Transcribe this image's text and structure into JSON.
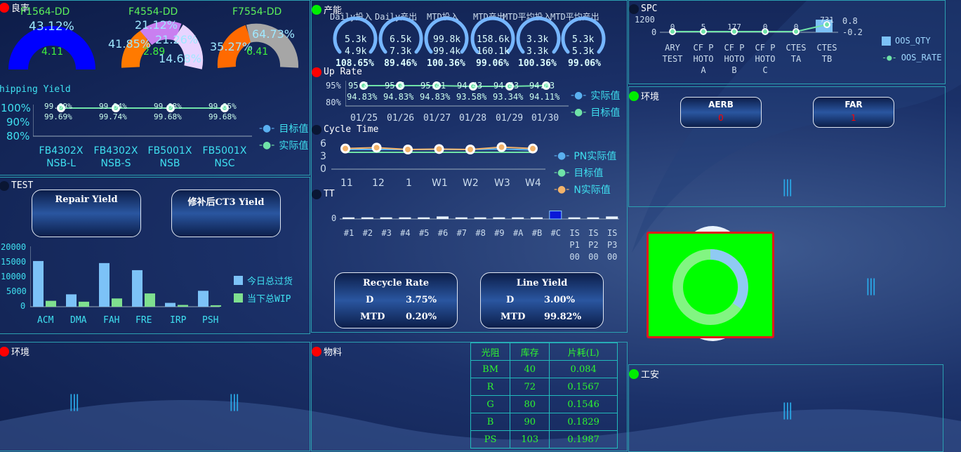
{
  "yield": {
    "title": "良率",
    "gauges": [
      {
        "name": "F1564-DD",
        "pct": "43.12%",
        "val": "4.11"
      },
      {
        "name": "F4554-DD",
        "pct_top": "21.12%",
        "pct_left": "41.85%",
        "pct_mid": "21.26%",
        "pct_right": "14.68%",
        "val": "2.89"
      },
      {
        "name": "F7554-DD",
        "pct_left": "35.27%",
        "pct_right": "64.73%",
        "val": "6.41"
      }
    ],
    "chipping_label": "hipping Yield",
    "yaxis": [
      "100%",
      "90%",
      "80%"
    ],
    "categories": [
      [
        "FB4302X",
        "NSB-L"
      ],
      [
        "FB4302X",
        "NSB-S"
      ],
      [
        "FB5001X",
        "NSB"
      ],
      [
        "FB5001X",
        "NSC"
      ]
    ],
    "target_labels": [
      "99.69%",
      "99.84%",
      "99.68%",
      "99.85%"
    ],
    "actual_labels": [
      "99.69%",
      "99.74%",
      "99.68%",
      "99.68%"
    ],
    "legend": [
      "目标值",
      "实际值"
    ]
  },
  "test": {
    "title": "TEST",
    "box1": "Repair Yield",
    "box2": "修补后CT3 Yield",
    "yaxis": [
      "20000",
      "15000",
      "10000",
      "5000",
      "0"
    ],
    "categories": [
      "ACM",
      "DMA",
      "FAH",
      "FRE",
      "IRP",
      "PSH"
    ],
    "legend": [
      "今日总过货",
      "当下总WIP"
    ],
    "chart_data": {
      "type": "bar",
      "categories": [
        "ACM",
        "DMA",
        "FAH",
        "FRE",
        "IRP",
        "PSH"
      ],
      "series": [
        {
          "name": "今日总过货",
          "values": [
            15500,
            4200,
            14800,
            12400,
            1300,
            5400
          ]
        },
        {
          "name": "当下总WIP",
          "values": [
            2000,
            1700,
            2800,
            4500,
            600,
            500
          ]
        }
      ],
      "ylim": [
        0,
        20000
      ]
    }
  },
  "env_left": {
    "title": "环境"
  },
  "capacity": {
    "title": "产能",
    "headers": [
      "Daily投入",
      "Daily产出",
      "MTD投入",
      "MTD产出",
      "MTD平均投入",
      "MTD平均产出"
    ],
    "gauges": [
      {
        "a": "5.3k",
        "b": "4.9k",
        "p": "108.65%"
      },
      {
        "a": "6.5k",
        "b": "7.3k",
        "p": "89.46%"
      },
      {
        "a": "99.8k",
        "b": "99.4k",
        "p": "100.36%"
      },
      {
        "a": "158.6k",
        "b": "160.1k",
        "p": "99.06%"
      },
      {
        "a": "3.3k",
        "b": "3.3k",
        "p": "100.36%"
      },
      {
        "a": "5.3k",
        "b": "5.3k",
        "p": "99.06%"
      }
    ]
  },
  "uprate": {
    "title": "Up Rate",
    "yaxis": [
      "95%",
      "80%"
    ],
    "dates": [
      "01/25",
      "01/26",
      "01/27",
      "01/28",
      "01/29",
      "01/30"
    ],
    "top_labels": [
      "95.4",
      "95.4",
      "95.41",
      "94.43",
      "94.43",
      "94.83"
    ],
    "bottom_labels": [
      "94.83%",
      "94.83%",
      "94.83%",
      "93.58%",
      "93.34%",
      "94.11%"
    ],
    "legend": [
      "实际值",
      "目标值"
    ]
  },
  "cycle": {
    "title": "Cycle Time",
    "yaxis": [
      "6",
      "3",
      "0"
    ],
    "categories": [
      "11",
      "12",
      "1",
      "W1",
      "W2",
      "W3",
      "W4"
    ],
    "legend": [
      "PN实际值",
      "目标值",
      "N实际值"
    ],
    "chart_data": {
      "type": "line",
      "categories": [
        "11",
        "12",
        "1",
        "W1",
        "W2",
        "W3",
        "W4"
      ],
      "series": [
        {
          "name": "PN实际值",
          "values": [
            4.2,
            4.2,
            4.2,
            4.2,
            4.2,
            4.3,
            4.1
          ]
        },
        {
          "name": "目标值",
          "values": [
            3.6,
            3.6,
            3.6,
            3.6,
            3.6,
            3.6,
            3.6
          ]
        },
        {
          "name": "N实际值",
          "values": [
            4.4,
            4.6,
            4.2,
            4.3,
            4.2,
            4.7,
            4.4
          ]
        }
      ],
      "ylim": [
        0,
        6
      ]
    }
  },
  "tt": {
    "title": "TT",
    "yaxis": [
      "0"
    ],
    "categories": [
      [
        "#1"
      ],
      [
        "#2"
      ],
      [
        "#3"
      ],
      [
        "#4"
      ],
      [
        "#5"
      ],
      [
        "#6"
      ],
      [
        "#7"
      ],
      [
        "#8"
      ],
      [
        "#9"
      ],
      [
        "#A"
      ],
      [
        "#B"
      ],
      [
        "#C"
      ],
      [
        "IS",
        "P1",
        "00"
      ],
      [
        "IS",
        "P2",
        "00"
      ],
      [
        "IS",
        "P3",
        "00"
      ]
    ],
    "values": [
      1,
      1,
      1,
      1,
      1,
      2,
      1,
      1,
      1,
      1,
      1,
      8,
      1,
      1,
      2
    ]
  },
  "recycle": {
    "title": "Recycle Rate",
    "rows": [
      [
        "D",
        "3.75%"
      ],
      [
        "MTD",
        "0.20%"
      ]
    ]
  },
  "lineyield": {
    "title": "Line Yield",
    "rows": [
      [
        "D",
        "3.00%"
      ],
      [
        "MTD",
        "99.82%"
      ]
    ]
  },
  "material": {
    "title": "物料",
    "headers": [
      "光阻",
      "库存",
      "片耗(L)"
    ],
    "rows": [
      [
        "BM",
        "40",
        "0.084"
      ],
      [
        "R",
        "72",
        "0.1567"
      ],
      [
        "G",
        "80",
        "0.1546"
      ],
      [
        "B",
        "90",
        "0.1829"
      ],
      [
        "PS",
        "103",
        "0.1987"
      ]
    ]
  },
  "spc": {
    "title": "SPC",
    "yleft": [
      "1200",
      "0"
    ],
    "yright": [
      "0.8",
      "-0.2"
    ],
    "categories": [
      [
        "ARY",
        "TEST"
      ],
      [
        "CF P",
        "HOTO",
        "A"
      ],
      [
        "CF P",
        "HOTO",
        "B"
      ],
      [
        "CF P",
        "HOTO",
        "C"
      ],
      [
        "CTES",
        "TA"
      ],
      [
        "CTES",
        "TB"
      ]
    ],
    "labels": [
      "0",
      "5",
      "177",
      "0",
      "0",
      "731"
    ],
    "legend": [
      "OOS_QTY",
      "OOS_RATE"
    ]
  },
  "env_right": {
    "title": "环境",
    "aerb": "AERB",
    "aerb_val": "0",
    "far": "FAR",
    "far_val": "1"
  },
  "safety": {
    "title": "工安"
  }
}
